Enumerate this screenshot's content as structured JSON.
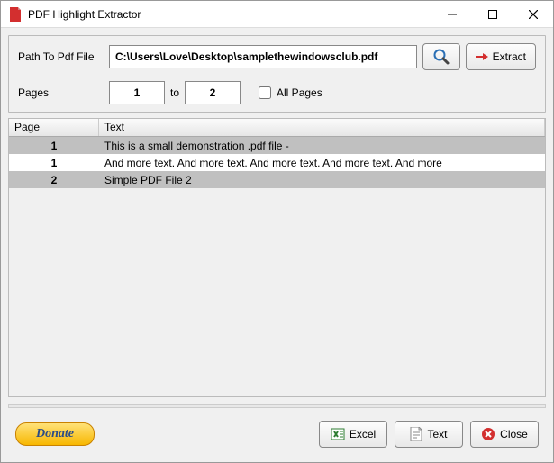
{
  "titlebar": {
    "title": "PDF Highlight Extractor"
  },
  "input": {
    "path_label": "Path To Pdf File",
    "path_value": "C:\\Users\\Love\\Desktop\\samplethewindowsclub.pdf",
    "pages_label": "Pages",
    "page_from": "1",
    "to_label": "to",
    "page_to": "2",
    "all_pages_label": "All Pages",
    "all_pages_checked": false,
    "extract_label": "Extract"
  },
  "table": {
    "headers": {
      "page": "Page",
      "text": "Text"
    },
    "rows": [
      {
        "page": "1",
        "text": "This is a small demonstration .pdf file -"
      },
      {
        "page": "1",
        "text": "And more text. And more text. And more text. And more text. And more"
      },
      {
        "page": "2",
        "text": "Simple PDF File 2"
      }
    ]
  },
  "footer": {
    "donate": "Donate",
    "excel": "Excel",
    "text": "Text",
    "close": "Close"
  }
}
